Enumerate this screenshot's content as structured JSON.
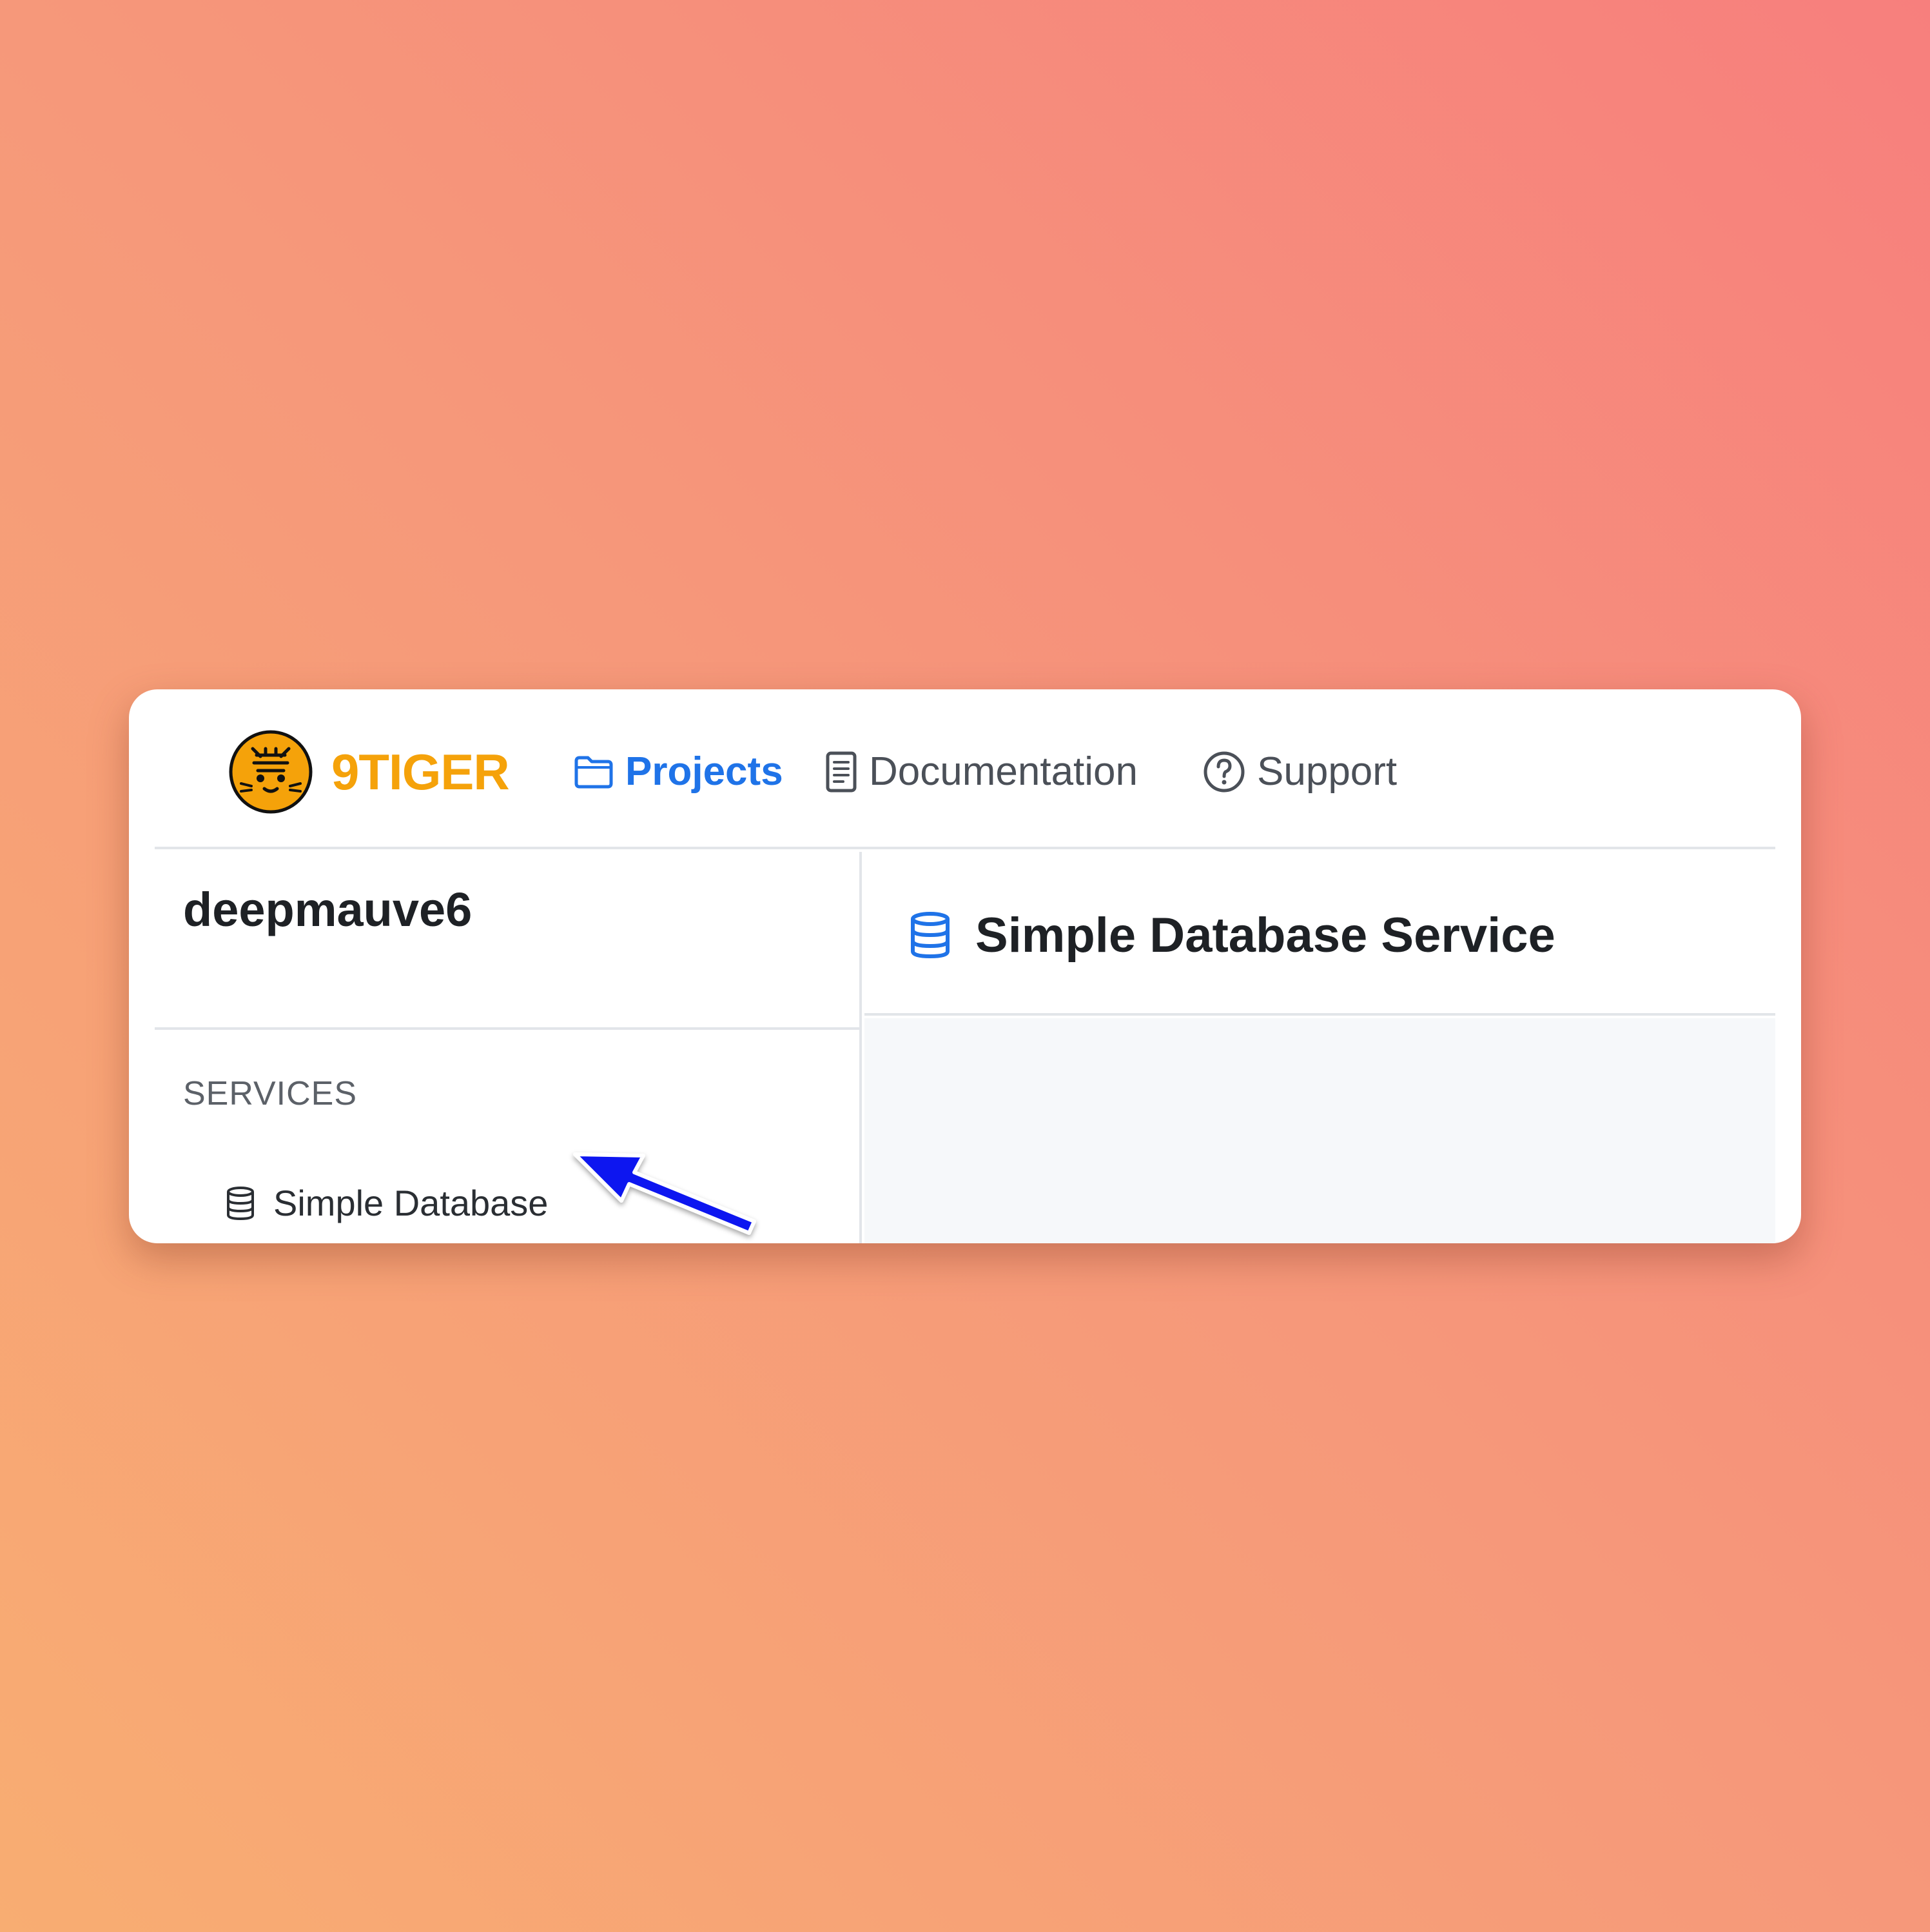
{
  "header": {
    "brand": "9TIGER",
    "nav": [
      {
        "label": "Projects",
        "icon": "folder-icon",
        "active": true
      },
      {
        "label": "Documentation",
        "icon": "document-icon"
      },
      {
        "label": "Support",
        "icon": "help-circle-icon"
      }
    ]
  },
  "sidebar": {
    "project_name": "deepmauve6",
    "section_label": "SERVICES",
    "items": [
      {
        "label": "Simple Database",
        "icon": "database-icon"
      }
    ]
  },
  "main": {
    "title": "Simple Database Service",
    "icon": "database-icon"
  },
  "colors": {
    "brand": "#f5a20a",
    "accent": "#1f73e8",
    "annotation_arrow": "#0a16f0"
  }
}
